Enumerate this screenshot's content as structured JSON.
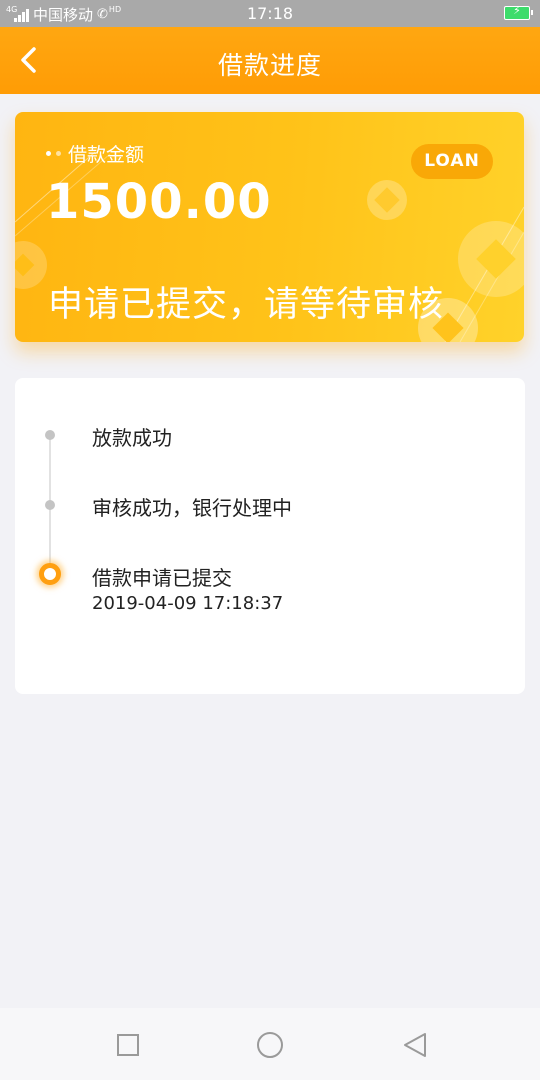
{
  "status_bar": {
    "network_tag": "4G",
    "carrier": "中国移动",
    "hd_tag": "HD",
    "time": "17:18",
    "battery_icon": "battery-charging-icon"
  },
  "header": {
    "title": "借款进度",
    "back_icon": "chevron-left-icon",
    "background": "#ff9f0a"
  },
  "loan_card": {
    "amount_label": "借款金额",
    "amount": "1500.00",
    "badge": "LOAN",
    "status_message": "申请已提交，请等待审核",
    "accent": "#ffb511"
  },
  "timeline": {
    "steps": [
      {
        "title": "放款成功",
        "time": "",
        "state": "pending"
      },
      {
        "title": "审核成功，银行处理中",
        "time": "",
        "state": "pending"
      },
      {
        "title": "借款申请已提交",
        "time": "2019-04-09 17:18:37",
        "state": "current"
      }
    ],
    "current_color": "#ff9f10"
  },
  "nav_bar": {
    "recent_icon": "square-icon",
    "home_icon": "circle-icon",
    "back_icon": "triangle-back-icon"
  }
}
